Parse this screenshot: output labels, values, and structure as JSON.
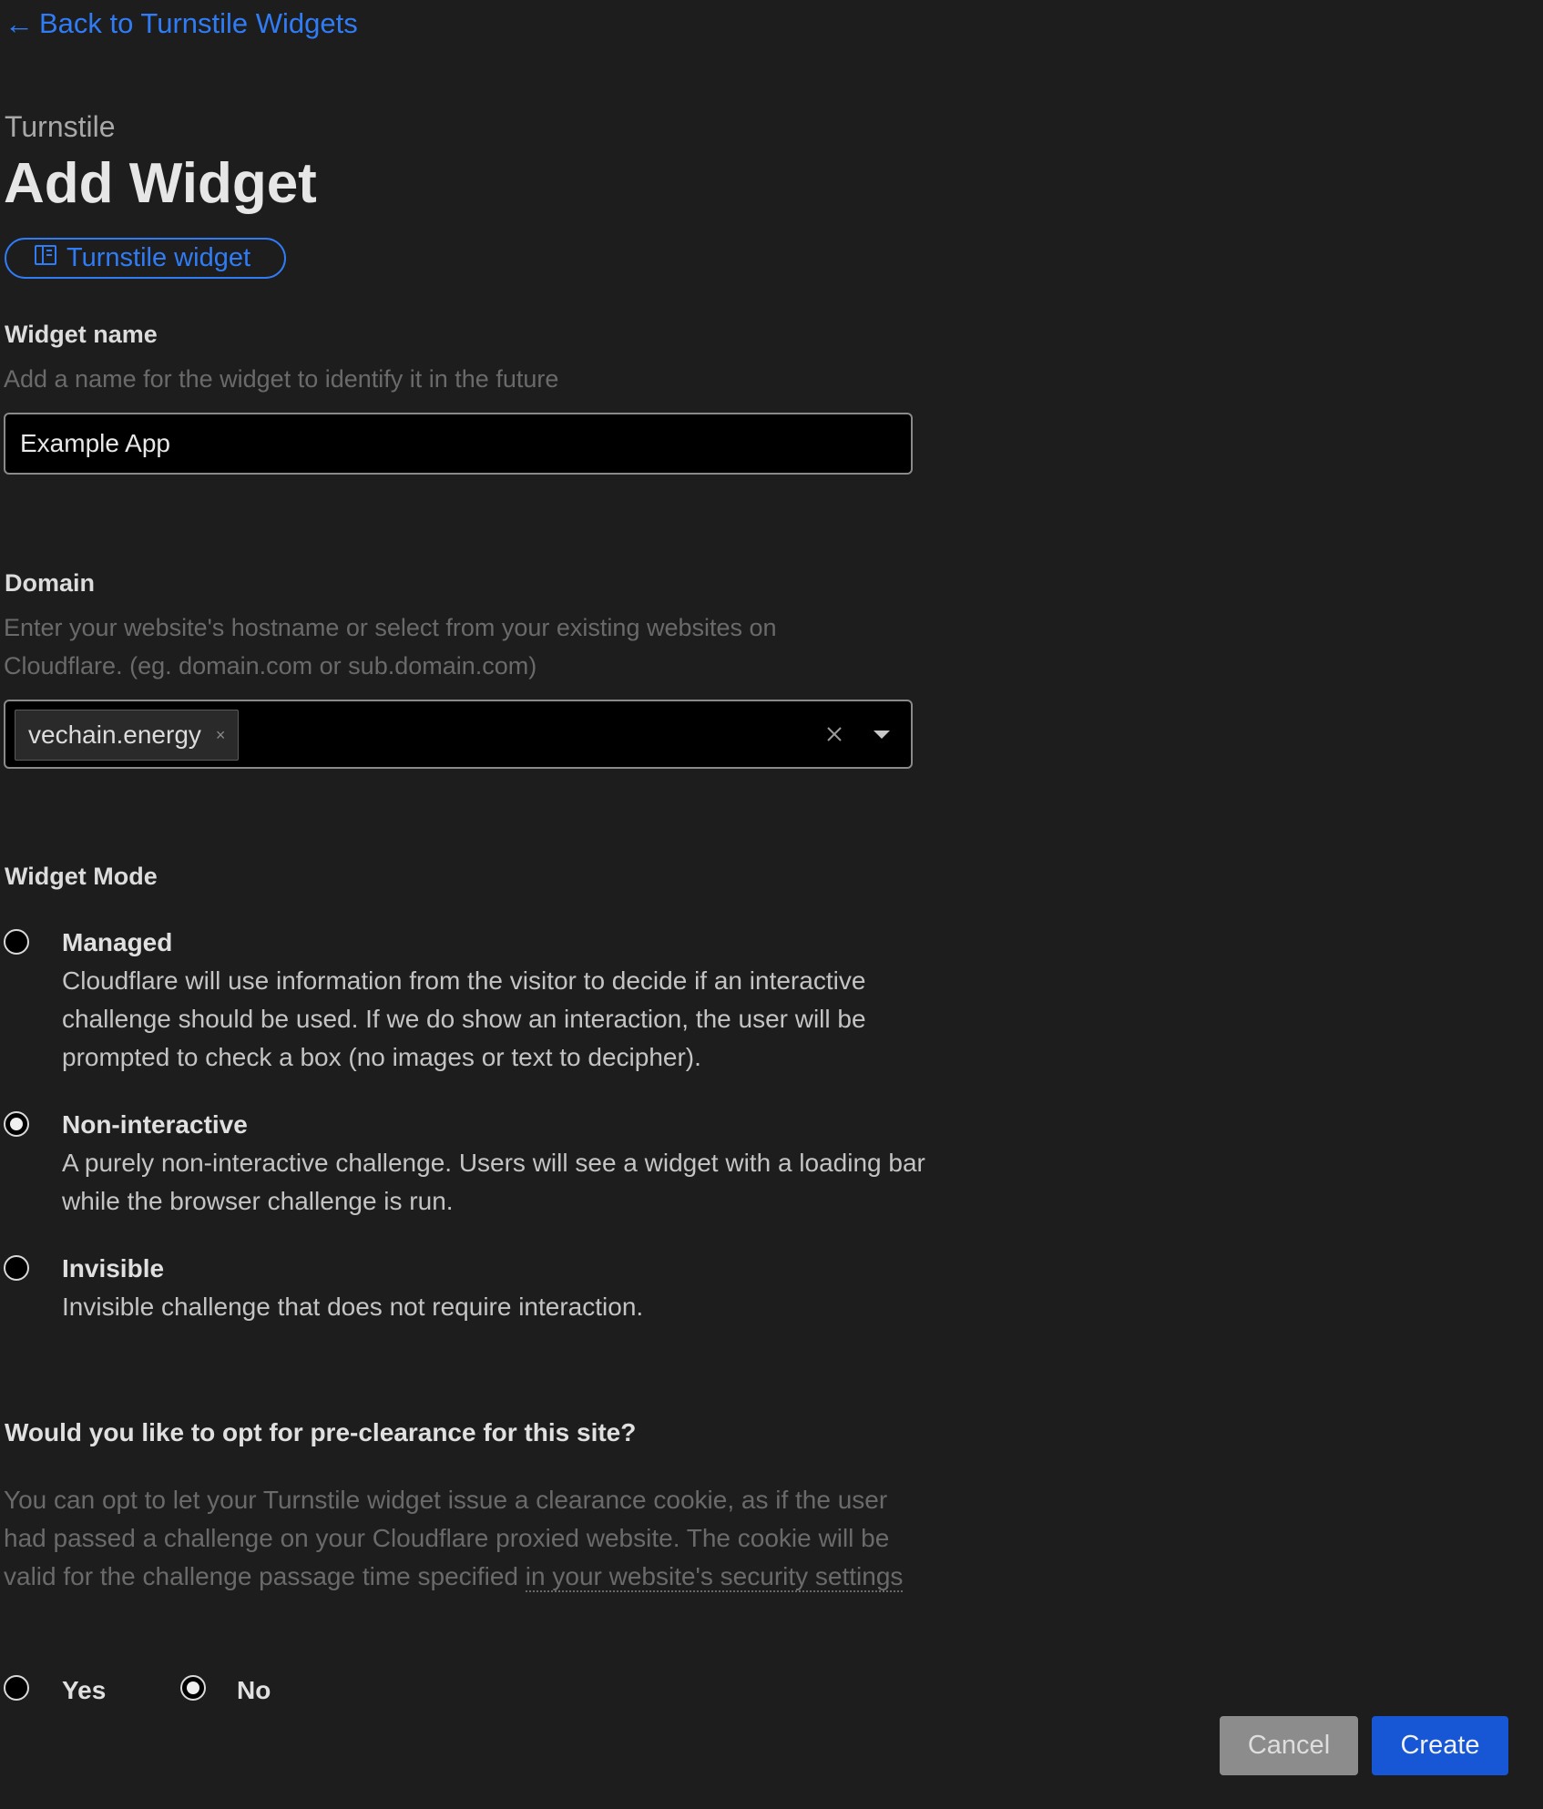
{
  "nav": {
    "back_label": "Back to Turnstile Widgets"
  },
  "header": {
    "product": "Turnstile",
    "title": "Add Widget",
    "docs_pill": "Turnstile widget"
  },
  "widget_name": {
    "label": "Widget name",
    "hint": "Add a name for the widget to identify it in the future",
    "value": "Example App"
  },
  "domain": {
    "label": "Domain",
    "hint": "Enter your website's hostname or select from your existing websites on Cloudflare. (eg. domain.com or sub.domain.com)",
    "chips": [
      "vechain.energy"
    ],
    "chip_remove_glyph": "×"
  },
  "widget_mode": {
    "label": "Widget Mode",
    "selected": "Non-interactive",
    "options": [
      {
        "title": "Managed",
        "description": "Cloudflare will use information from the visitor to decide if an interactive challenge should be used. If we do show an interaction, the user will be prompted to check a box (no images or text to decipher)."
      },
      {
        "title": "Non-interactive",
        "description": "A purely non-interactive challenge. Users will see a widget with a loading bar while the browser challenge is run."
      },
      {
        "title": "Invisible",
        "description": "Invisible challenge that does not require interaction."
      }
    ]
  },
  "preclearance": {
    "question": "Would you like to opt for pre-clearance for this site?",
    "description": "You can opt to let your Turnstile widget issue a clearance cookie, as if the user had passed a challenge on your Cloudflare proxied website. The cookie will be valid for the challenge passage time specified ",
    "link_text": "in your website's security settings",
    "yes_label": "Yes",
    "no_label": "No",
    "selected": "No"
  },
  "actions": {
    "cancel_label": "Cancel",
    "create_label": "Create"
  },
  "icons": {
    "back": "arrow-left-icon",
    "docs": "book-icon",
    "clear": "close-icon",
    "dropdown": "caret-down-icon"
  },
  "colors": {
    "background": "#1d1d1d",
    "link": "#2f7cf6",
    "primary_button": "#1757d6",
    "secondary_button": "#8c8c8c"
  }
}
